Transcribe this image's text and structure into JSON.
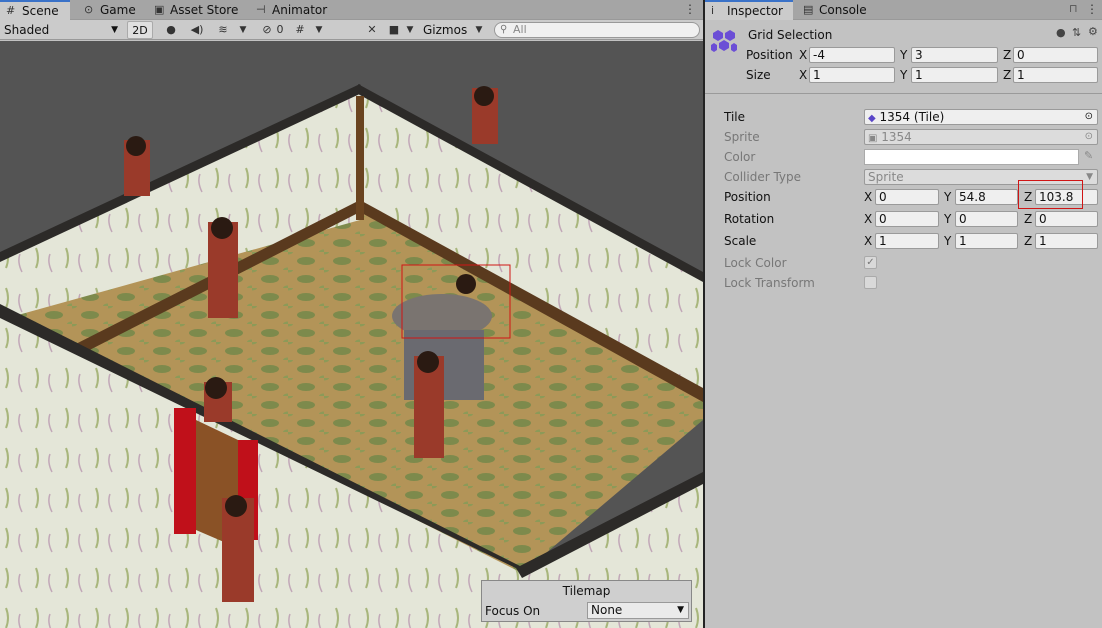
{
  "scene_tabs": [
    {
      "label": "Scene",
      "icon": "#"
    },
    {
      "label": "Game",
      "icon": "⊙"
    },
    {
      "label": "Asset Store",
      "icon": "▣"
    },
    {
      "label": "Animator",
      "icon": "⊣"
    }
  ],
  "toolbar": {
    "shading_mode": "Shaded",
    "mode_2d": "2D",
    "hidden_count": "0",
    "gizmos_label": "Gizmos",
    "search_placeholder": "All"
  },
  "inspector_tabs": [
    {
      "label": "Inspector",
      "icon": "i"
    },
    {
      "label": "Console",
      "icon": "▤"
    }
  ],
  "grid_selection": {
    "title": "Grid Selection",
    "position_label": "Position",
    "position": {
      "x": "-4",
      "y": "3",
      "z": "0"
    },
    "size_label": "Size",
    "size": {
      "x": "1",
      "y": "1",
      "z": "1"
    }
  },
  "axes": {
    "x": "X",
    "y": "Y",
    "z": "Z"
  },
  "tile": {
    "tile_label": "Tile",
    "tile_value": "1354 (Tile)",
    "sprite_label": "Sprite",
    "sprite_value": "1354",
    "color_label": "Color",
    "collider_label": "Collider Type",
    "collider_value": "Sprite",
    "position_label": "Position",
    "position": {
      "x": "0",
      "y": "54.8",
      "z": "103.8"
    },
    "rotation_label": "Rotation",
    "rotation": {
      "x": "0",
      "y": "0",
      "z": "0"
    },
    "scale_label": "Scale",
    "scale": {
      "x": "1",
      "y": "1",
      "z": "1"
    },
    "lock_color_label": "Lock Color",
    "lock_transform_label": "Lock Transform"
  },
  "tilemap_overlay": {
    "title": "Tilemap",
    "focus_label": "Focus On",
    "focus_value": "None"
  },
  "colors": {
    "accent_tab": "#3a72c8",
    "highlight": "#d01515",
    "scene_bg": "#545454",
    "floor": "#b09054",
    "wall": "#e2e4d4",
    "wall_top": "#5a3a1e",
    "door": "#c0101a"
  }
}
